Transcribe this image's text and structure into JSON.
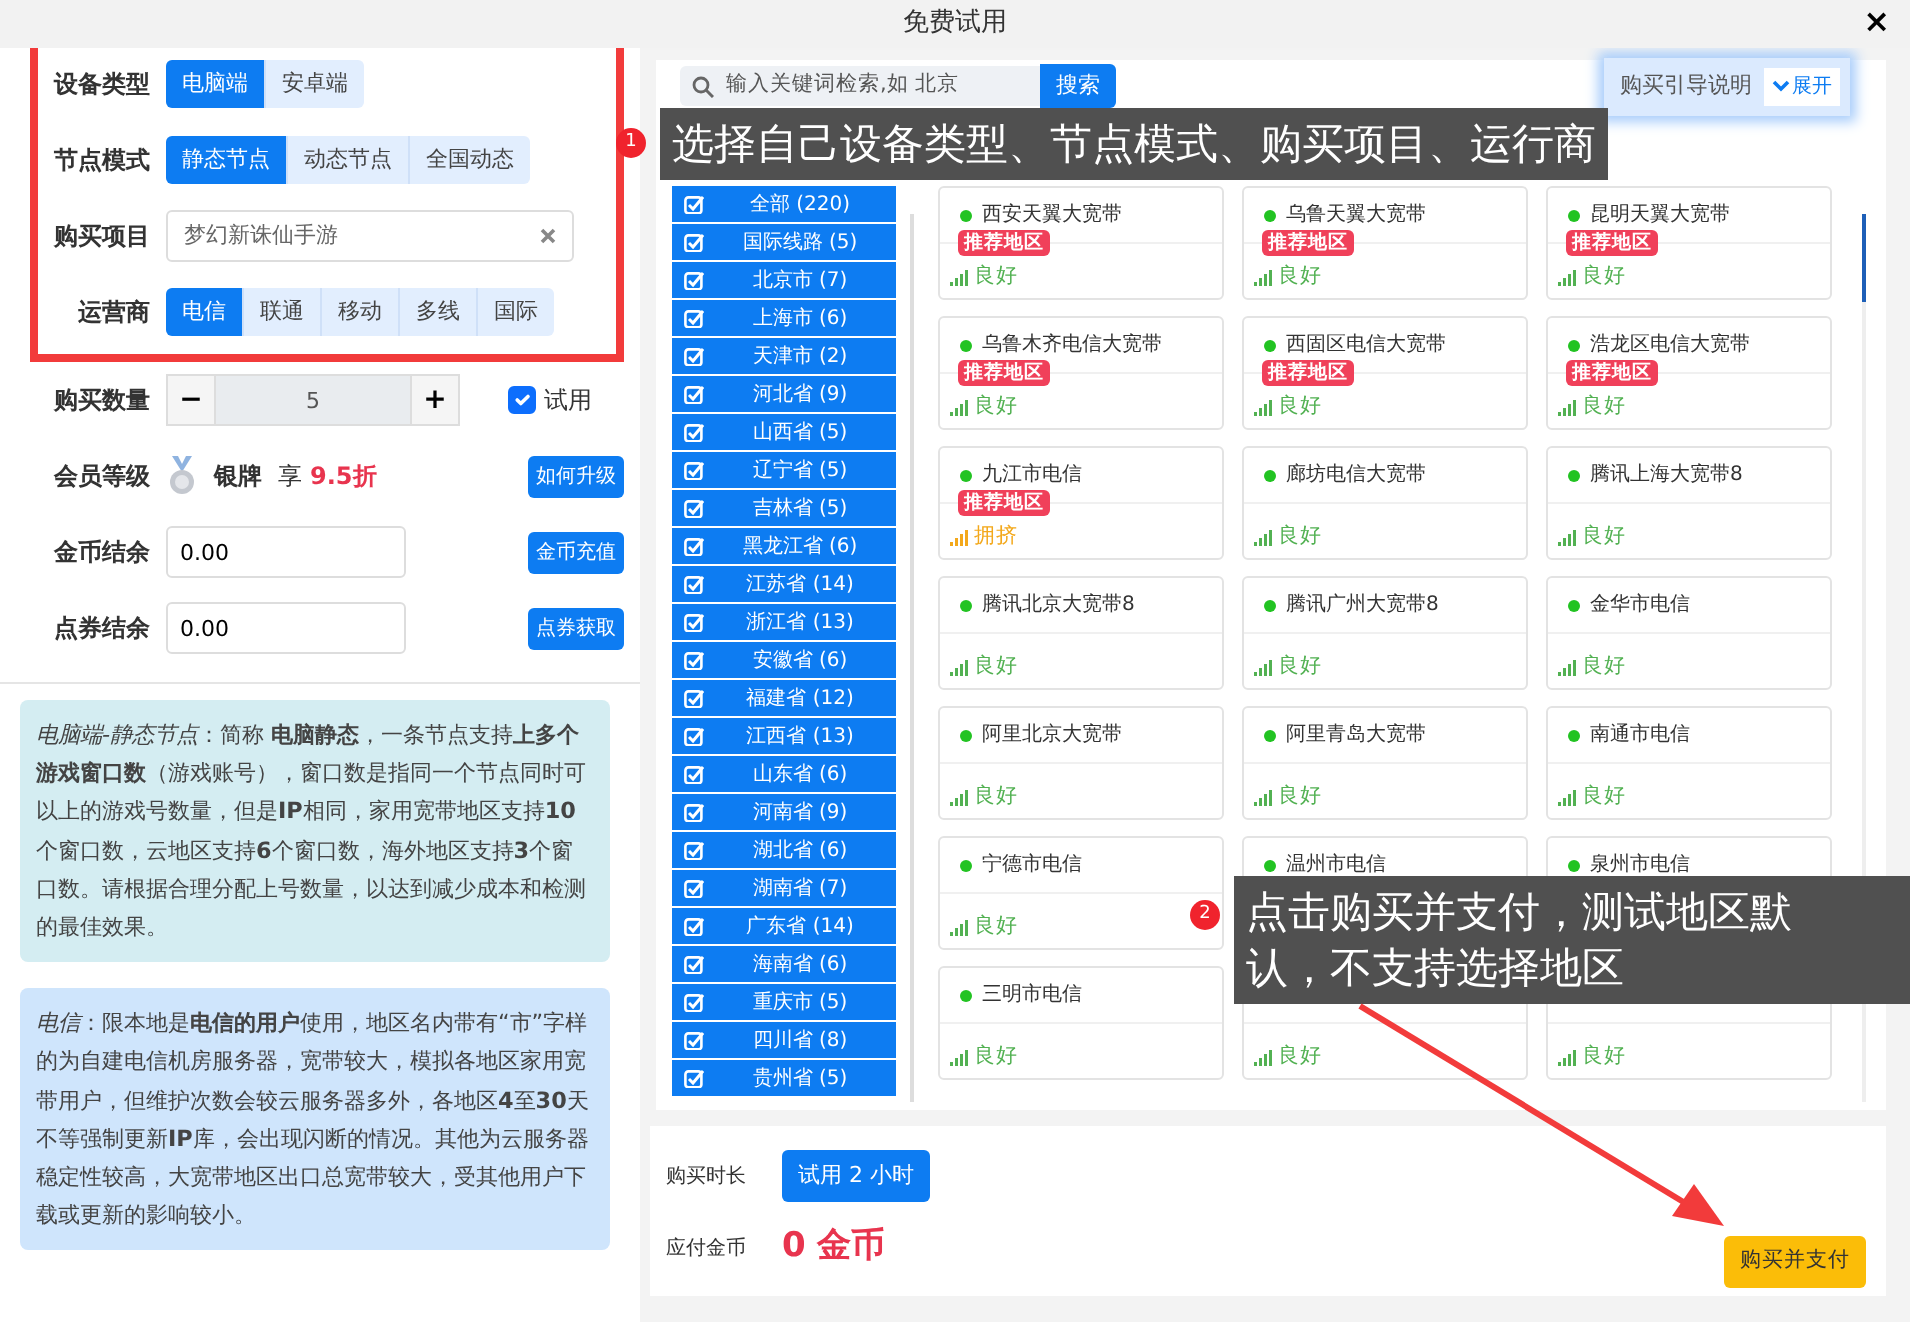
{
  "window": {
    "title": "免费试用",
    "close": "×"
  },
  "form_rows": [
    {
      "kind": "segmented",
      "label": "设备类型",
      "highlighted": true,
      "options": [
        {
          "label": "电脑端",
          "selected": true
        },
        {
          "label": "安卓端",
          "selected": false
        }
      ]
    },
    {
      "kind": "segmented",
      "label": "节点模式",
      "highlighted": true,
      "options": [
        {
          "label": "静态节点",
          "selected": true
        },
        {
          "label": "动态节点",
          "selected": false
        },
        {
          "label": "全国动态",
          "selected": false
        }
      ]
    },
    {
      "kind": "project",
      "label": "购买项目",
      "highlighted": true,
      "value": "梦幻新诛仙手游"
    },
    {
      "kind": "segmented",
      "label": "运营商",
      "highlighted": true,
      "options": [
        {
          "label": "电信",
          "selected": true
        },
        {
          "label": "联通",
          "selected": false
        },
        {
          "label": "移动",
          "selected": false
        },
        {
          "label": "多线",
          "selected": false
        },
        {
          "label": "国际",
          "selected": false
        }
      ]
    },
    {
      "kind": "stepper",
      "label": "购买数量",
      "highlighted": false,
      "value": "5",
      "minus": "−",
      "plus": "+",
      "checkbox": {
        "label": "试用",
        "checked": true
      }
    },
    {
      "kind": "member",
      "label": "会员等级",
      "highlighted": false,
      "level_name": "银牌",
      "enjoy": "享",
      "discount": "9.5折",
      "button": "如何升级"
    },
    {
      "kind": "balance",
      "label": "金币结余",
      "highlighted": false,
      "value": "0.00",
      "button": "金币充值"
    },
    {
      "kind": "balance",
      "label": "点券结余",
      "highlighted": false,
      "value": "0.00",
      "button": "点券获取"
    }
  ],
  "notes": [
    {
      "color": "#d4edf2",
      "text": "*电脑端-静态节点*：简称 **电脑静态**，一条节点支持**上多个游戏窗口数**（游戏账号），窗口数是指同一个节点同时可以上的游戏号数量，但是**IP**相同，家用宽带地区支持**10**个窗口数，云地区支持**6**个窗口数，海外地区支持**3**个窗口数。请根据合理分配上号数量，以达到减少成本和检测的最佳效果。"
    },
    {
      "color": "#cfe5fc",
      "text": "*电信*：限本地是**电信的用户**使用，地区名内带有“市”字样的为自建电信机房服务器，宽带较大，模拟各地区家用宽带用户，但维护次数会较云服务器多外，各地区**4**至**30**天不等强制更新**IP**库，会出现闪断的情况。其他为云服务器稳定性较高，大宽带地区出口总宽带较大，受其他用户下载或更新的影响较小。"
    }
  ],
  "search": {
    "placeholder": "输入关键词检索,如 北京",
    "button": "搜索"
  },
  "guide": {
    "label": "购买引导说明",
    "toggle": "展开"
  },
  "regions": [
    {
      "label": "全部 (220)",
      "checked": true
    },
    {
      "label": "国际线路 (5)",
      "checked": true
    },
    {
      "label": "北京市 (7)",
      "checked": true
    },
    {
      "label": "上海市 (6)",
      "checked": true
    },
    {
      "label": "天津市 (2)",
      "checked": true
    },
    {
      "label": "河北省 (9)",
      "checked": true
    },
    {
      "label": "山西省 (5)",
      "checked": true
    },
    {
      "label": "辽宁省 (5)",
      "checked": true
    },
    {
      "label": "吉林省 (5)",
      "checked": true
    },
    {
      "label": "黑龙江省 (6)",
      "checked": true
    },
    {
      "label": "江苏省 (14)",
      "checked": true
    },
    {
      "label": "浙江省 (13)",
      "checked": true
    },
    {
      "label": "安徽省 (6)",
      "checked": true
    },
    {
      "label": "福建省 (12)",
      "checked": true
    },
    {
      "label": "江西省 (13)",
      "checked": true
    },
    {
      "label": "山东省 (6)",
      "checked": true
    },
    {
      "label": "河南省 (9)",
      "checked": true
    },
    {
      "label": "湖北省 (6)",
      "checked": true
    },
    {
      "label": "湖南省 (7)",
      "checked": true
    },
    {
      "label": "广东省 (14)",
      "checked": true
    },
    {
      "label": "海南省 (6)",
      "checked": true
    },
    {
      "label": "重庆市 (5)",
      "checked": true
    },
    {
      "label": "四川省 (8)",
      "checked": true
    },
    {
      "label": "贵州省 (5)",
      "checked": true
    }
  ],
  "nodes": [
    {
      "name": "西安天翼大宽带",
      "badge": "推荐地区",
      "status": {
        "kind": "good",
        "text": "良好"
      }
    },
    {
      "name": "乌鲁天翼大宽带",
      "badge": "推荐地区",
      "status": {
        "kind": "good",
        "text": "良好"
      }
    },
    {
      "name": "昆明天翼大宽带",
      "badge": "推荐地区",
      "status": {
        "kind": "good",
        "text": "良好"
      }
    },
    {
      "name": "乌鲁木齐电信大宽带",
      "badge": "推荐地区",
      "status": {
        "kind": "good",
        "text": "良好"
      }
    },
    {
      "name": "西固区电信大宽带",
      "badge": "推荐地区",
      "status": {
        "kind": "good",
        "text": "良好"
      }
    },
    {
      "name": "浩龙区电信大宽带",
      "badge": "推荐地区",
      "status": {
        "kind": "good",
        "text": "良好"
      }
    },
    {
      "name": "九江市电信",
      "badge": "推荐地区",
      "status": {
        "kind": "busy",
        "text": "拥挤"
      }
    },
    {
      "name": "廊坊电信大宽带",
      "status": {
        "kind": "good",
        "text": "良好"
      }
    },
    {
      "name": "腾讯上海大宽带8",
      "status": {
        "kind": "good",
        "text": "良好"
      }
    },
    {
      "name": "腾讯北京大宽带8",
      "status": {
        "kind": "good",
        "text": "良好"
      }
    },
    {
      "name": "腾讯广州大宽带8",
      "status": {
        "kind": "good",
        "text": "良好"
      }
    },
    {
      "name": "金华市电信",
      "status": {
        "kind": "good",
        "text": "良好"
      }
    },
    {
      "name": "阿里北京大宽带",
      "status": {
        "kind": "good",
        "text": "良好"
      }
    },
    {
      "name": "阿里青岛大宽带",
      "status": {
        "kind": "good",
        "text": "良好"
      }
    },
    {
      "name": "南通市电信",
      "status": {
        "kind": "good",
        "text": "良好"
      }
    },
    {
      "name": "宁德市电信",
      "status": {
        "kind": "good",
        "text": "良好"
      }
    },
    {
      "name": "温州市电信"
    },
    {
      "name": "泉州市电信"
    },
    {
      "name": "三明市电信",
      "status": {
        "kind": "good",
        "text": "良好"
      }
    },
    {
      "status": {
        "kind": "good",
        "text": "良好"
      }
    },
    {
      "status": {
        "kind": "good",
        "text": "良好"
      }
    }
  ],
  "bottom": {
    "duration_label": "购买时长",
    "duration": "试用 2 小时",
    "cost_label": "应付金币",
    "cost": "0 金币",
    "pay": "购买并支付"
  },
  "annotations": [
    {
      "number": "1",
      "text": "选择自己设备类型、节点模式、购买项目、运行商"
    },
    {
      "number": "2",
      "text": "点击购买并支付，测试地区默认，不支持选择地区"
    }
  ]
}
